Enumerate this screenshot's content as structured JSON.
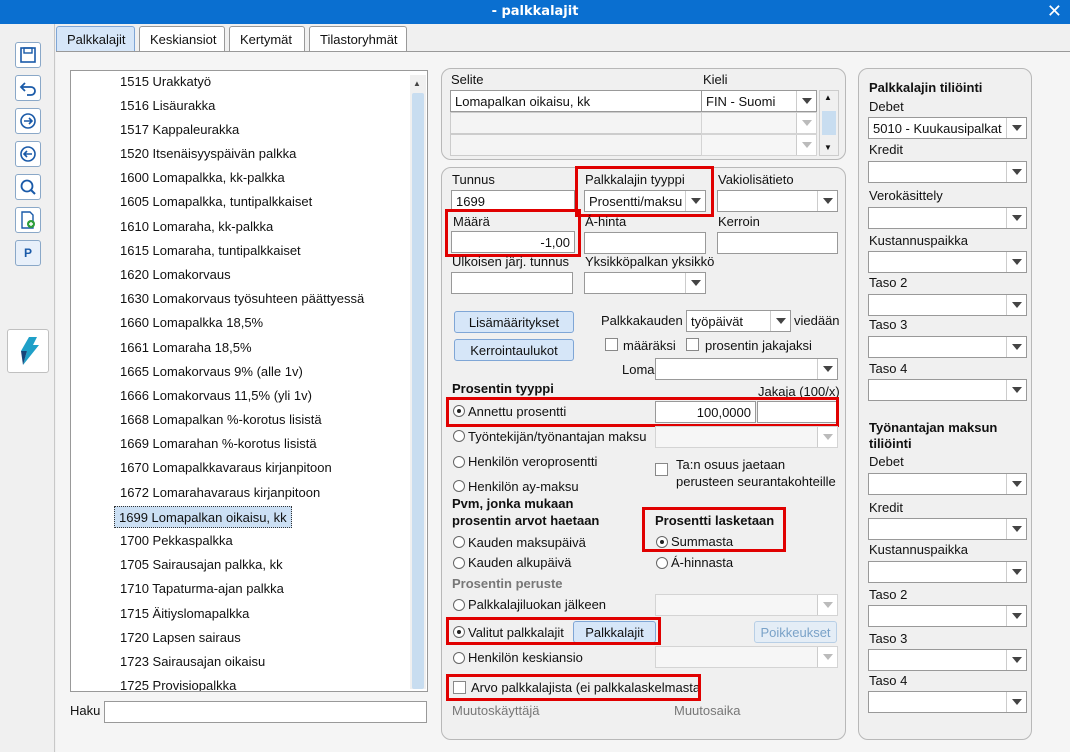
{
  "window": {
    "title": "- palkkalajit",
    "close": "✕"
  },
  "tabs": [
    "Palkkalajit",
    "Keskiansiot",
    "Kertymät",
    "Tilastoryhmät"
  ],
  "toolbar": {
    "p_label": "P"
  },
  "list": {
    "items": [
      "1515 Urakkatyö",
      "1516 Lisäurakka",
      "1517 Kappaleurakka",
      "1520 Itsenäisyyspäivän palkka",
      "1600 Lomapalkka, kk-palkka",
      "1605 Lomapalkka, tuntipalkkaiset",
      "1610 Lomaraha, kk-palkka",
      "1615 Lomaraha, tuntipalkkaiset",
      "1620 Lomakorvaus",
      "1630 Lomakorvaus työsuhteen päättyessä",
      "1660 Lomapalkka 18,5%",
      "1661 Lomaraha 18,5%",
      "1665 Lomakorvaus 9% (alle 1v)",
      "1666 Lomakorvaus 11,5% (yli 1v)",
      "1668 Lomapalkan %-korotus lisistä",
      "1669 Lomarahan %-korotus lisistä",
      "1670 Lomapalkkavaraus kirjanpitoon",
      "1672 Lomarahavaraus kirjanpitoon",
      "1699 Lomapalkan oikaisu, kk",
      "1700 Pekkaspalkka",
      "1705 Sairausajan palkka, kk",
      "1710 Tapaturma-ajan palkka",
      "1715 Äitiyslomapalkka",
      "1720 Lapsen sairaus",
      "1723 Sairausajan oikaisu",
      "1725 Provisiopalkka"
    ],
    "selected_index": 18,
    "search_label": "Haku",
    "search_value": ""
  },
  "selite": {
    "label": "Selite",
    "kieli_label": "Kieli",
    "value": "Lomapalkan oikaisu, kk",
    "kieli_value": "FIN - Suomi"
  },
  "form": {
    "tunnus_label": "Tunnus",
    "tunnus_value": "1699",
    "tyyppi_label": "Palkkalajin tyyppi",
    "tyyppi_value": "Prosentti/maksu",
    "vakio_label": "Vakiolisätieto",
    "maara_label": "Määrä",
    "maara_value": "-1,00",
    "ahinta_label": "Á-hinta",
    "kerroin_label": "Kerroin",
    "ulkoisen_label": "Ulkoisen järj. tunnus",
    "yksikko_label": "Yksikköpalkan yksikkö",
    "lisamaaritykset": "Lisämääritykset",
    "kerrointaulukot": "Kerrointaulukot",
    "palkkakauden_label": "Palkkakauden",
    "palkkakauden_value": "työpäivät",
    "viedaan_label": "viedään",
    "maaraksi": "määräksi",
    "prosentin_jakajaksi": "prosentin jakajaksi",
    "loma_label": "Loma",
    "prosentin_tyyppi": "Prosentin tyyppi",
    "jakaja_label": "Jakaja (100/x)",
    "annettu_prosentti": "Annettu prosentti",
    "annettu_value": "100,0000",
    "tyontekijan": "Työntekijän/työnantajan maksu",
    "veroprosentti": "Henkilön veroprosentti",
    "aymaksu": "Henkilön ay-maksu",
    "tan_osuus": "Ta:n osuus jaetaan perusteen seurantakohteille",
    "pvm_heading": "Pvm, jonka mukaan prosentin arvot haetaan",
    "kauden_maksupaiva": "Kauden maksupäivä",
    "kauden_alkupaiva": "Kauden alkupäivä",
    "prosentti_lasketaan": "Prosentti lasketaan",
    "summasta": "Summasta",
    "ahinnasta": "Á-hinnasta",
    "prosentin_peruste": "Prosentin peruste",
    "palkkalajiluokan": "Palkkalajiluokan jälkeen",
    "valitut": "Valitut palkkalajit",
    "palkkalajit_btn": "Palkkalajit",
    "poikkeukset_btn": "Poikkeukset",
    "keskiansio": "Henkilön keskiansio",
    "arvo_palkkalajista": "Arvo palkkalajista (ei palkkalaskelmasta",
    "muutoskayttaja": "Muutoskäyttäjä",
    "muutosaika": "Muutosaika"
  },
  "tiliointi": {
    "heading": "Palkkalajin tiliöinti",
    "debet_label": "Debet",
    "debet_value": "5010 - Kuukausipalkat",
    "kredit_label": "Kredit",
    "verokasittely_label": "Verokäsittely",
    "kustannuspaikka_label": "Kustannuspaikka",
    "taso2_label": "Taso 2",
    "taso3_label": "Taso 3",
    "taso4_label": "Taso 4",
    "tyonantajan_heading": "Työnantajan maksun tiliöinti",
    "t_debet_label": "Debet",
    "t_kredit_label": "Kredit",
    "t_kustannuspaikka_label": "Kustannuspaikka",
    "t_taso2_label": "Taso 2",
    "t_taso3_label": "Taso 3",
    "t_taso4_label": "Taso 4"
  },
  "colors": {
    "accent": "#0a6fd0",
    "highlight": "#e00000",
    "selection": "#cce0f4"
  }
}
